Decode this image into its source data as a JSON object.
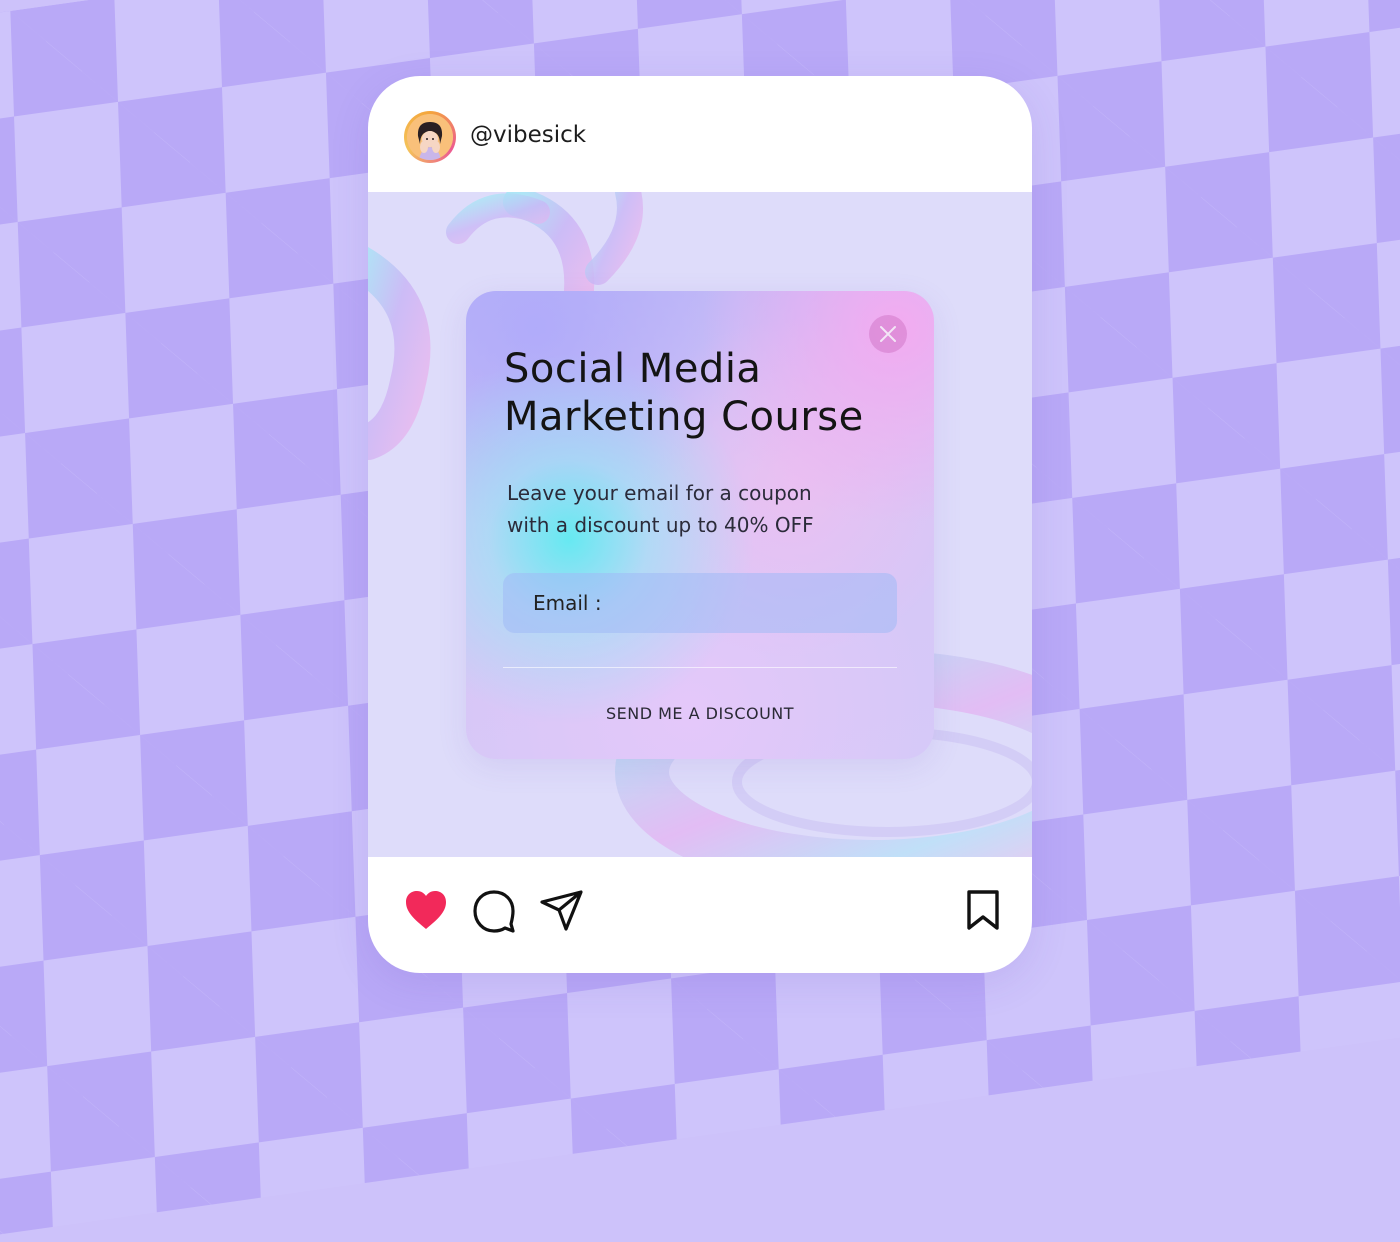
{
  "post": {
    "username": "@vibesick",
    "avatar_icon": "user-avatar",
    "background_color": "#dedcfa"
  },
  "popup": {
    "title_line1": "Social Media",
    "title_line2": "Marketing Course",
    "subtitle_line1": "Leave your email for a coupon",
    "subtitle_line2": "with a discount up to 40% OFF",
    "email_label": "Email :",
    "send_button": "SEND ME A DISCOUNT",
    "close_icon": "close-icon"
  },
  "actions": {
    "like_icon": "heart-icon",
    "like_color": "#f2295a",
    "comment_icon": "comment-icon",
    "share_icon": "send-icon",
    "save_icon": "bookmark-icon"
  },
  "theme": {
    "page_background": "#cdc2fa",
    "checker_dark": "#b9a9f7"
  }
}
